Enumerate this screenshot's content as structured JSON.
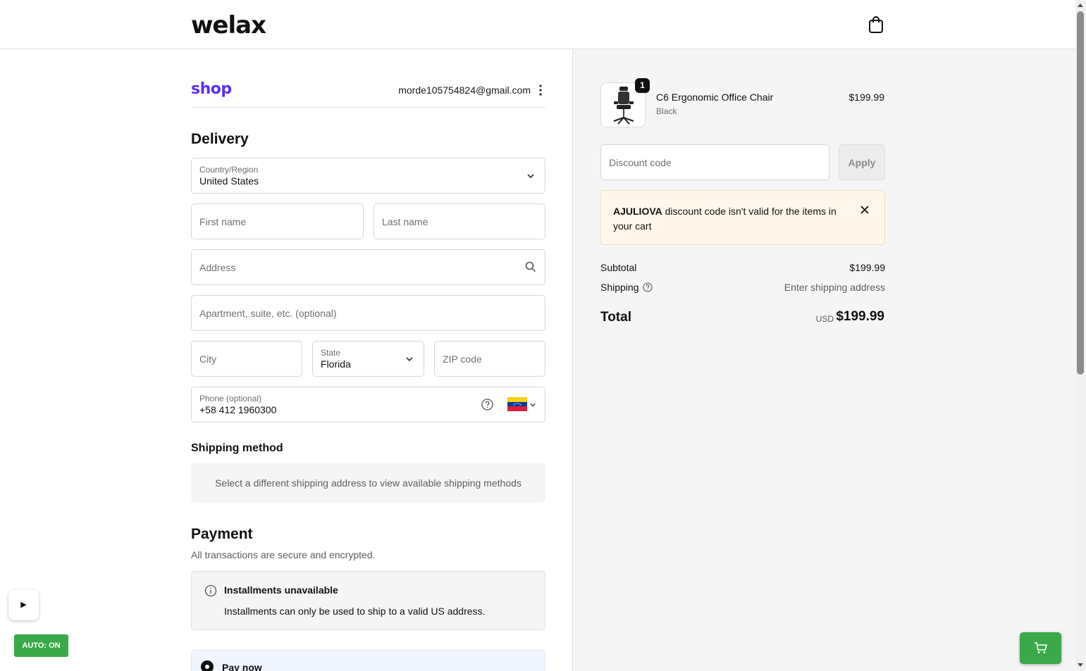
{
  "header": {
    "logo": "welax",
    "cart_icon": "shopping-bag-icon"
  },
  "shop": {
    "logo": "shop",
    "email": "morde105754824@gmail.com"
  },
  "delivery": {
    "title": "Delivery",
    "country_label": "Country/Region",
    "country_value": "United States",
    "first_name_ph": "First name",
    "last_name_ph": "Last name",
    "address_ph": "Address",
    "apartment_ph": "Apartment, suite, etc. (optional)",
    "city_ph": "City",
    "state_label": "State",
    "state_value": "Florida",
    "zip_ph": "ZIP code",
    "phone_label": "Phone (optional)",
    "phone_value": "+58 412 1960300"
  },
  "shipping": {
    "title": "Shipping method",
    "message": "Select a different shipping address to view available shipping methods"
  },
  "payment": {
    "title": "Payment",
    "subtitle": "All transactions are secure and encrypted.",
    "installments_title": "Installments unavailable",
    "installments_message": "Installments can only be used to ship to a valid US address.",
    "pay_now_label": "Pay now"
  },
  "order": {
    "product_name": "C6 Ergonomic Office Chair",
    "product_variant": "Black",
    "product_price": "$199.99",
    "quantity": "1",
    "discount_ph": "Discount code",
    "apply_label": "Apply",
    "warning_code": "AJULIOVA",
    "warning_text": " discount code isn't valid for the items in your cart",
    "subtotal_label": "Subtotal",
    "subtotal_value": "$199.99",
    "shipping_label": "Shipping",
    "shipping_value": "Enter shipping address",
    "total_label": "Total",
    "total_currency": "USD",
    "total_value": "$199.99"
  },
  "overlay": {
    "play_label": "▶",
    "auto_label": "AUTO: ON"
  },
  "colors": {
    "shop_purple": "#5a31f4",
    "overlay_green": "#3ba84a",
    "warning_bg": "#fff7ec"
  }
}
